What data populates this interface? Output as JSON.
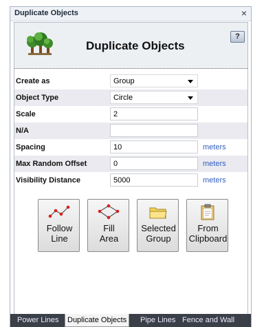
{
  "window": {
    "title": "Duplicate Objects",
    "close_glyph": "×"
  },
  "header": {
    "title": "Duplicate Objects",
    "icon": "trees-icon",
    "help_label": "?"
  },
  "form": {
    "create_as": {
      "label": "Create as",
      "value": "Group"
    },
    "object_type": {
      "label": "Object Type",
      "value": "Circle"
    },
    "scale": {
      "label": "Scale",
      "value": "2"
    },
    "na": {
      "label": "N/A",
      "value": ""
    },
    "spacing": {
      "label": "Spacing",
      "value": "10",
      "unit": "meters"
    },
    "max_random_offset": {
      "label": "Max Random Offset",
      "value": "0",
      "unit": "meters"
    },
    "visibility_distance": {
      "label": "Visibility Distance",
      "value": "5000",
      "unit": "meters"
    }
  },
  "actions": {
    "follow_line": {
      "line1": "Follow",
      "line2": "Line",
      "icon": "polyline-icon"
    },
    "fill_area": {
      "line1": "Fill",
      "line2": "Area",
      "icon": "polygon-icon"
    },
    "selected_group": {
      "line1": "Selected",
      "line2": "Group",
      "icon": "folder-icon"
    },
    "from_clipboard": {
      "line1": "From",
      "line2": "Clipboard",
      "icon": "clipboard-icon"
    }
  },
  "tabs": [
    "Power Lines",
    "Duplicate Objects",
    "Pipe Lines",
    "Fence and Wall"
  ],
  "colors": {
    "unit_link": "#2f5fbf",
    "tab_bar": "#3a3f48",
    "row_alt": "#eaeaf0"
  }
}
